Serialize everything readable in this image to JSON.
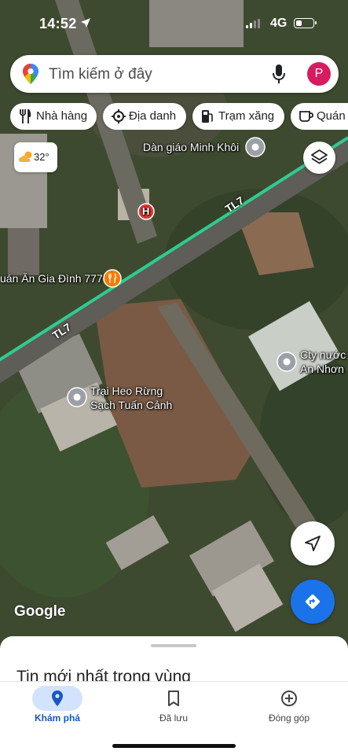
{
  "status_bar": {
    "time": "14:52",
    "network": "4G",
    "battery_level": 0.35
  },
  "search": {
    "placeholder": "Tìm kiếm ở đây",
    "avatar_letter": "P",
    "avatar_color": "#d81b60"
  },
  "chips": [
    {
      "label": "Nhà hàng",
      "icon": "utensils-icon"
    },
    {
      "label": "Địa danh",
      "icon": "landmark-icon"
    },
    {
      "label": "Trạm xăng",
      "icon": "fuel-icon"
    },
    {
      "label": "Quán",
      "icon": "coffee-icon"
    }
  ],
  "weather": {
    "temperature": "32°",
    "icon": "partly-cloudy-icon"
  },
  "map": {
    "road_name": "TL7",
    "road_color": "#2ecc8f",
    "places": [
      {
        "name": "Dàn giáo Minh Khôi",
        "icon": "pin-icon"
      },
      {
        "name": "uán Ăn Gia Đình 777",
        "icon": "restaurant-icon"
      },
      {
        "name": "Trại Heo Rừng",
        "name2": "Sạch Tuấn Cảnh",
        "icon": "pin-icon"
      },
      {
        "name": "Cty nước",
        "name2": "An Nhơn",
        "icon": "pin-icon"
      },
      {
        "name": "H",
        "icon": "hospital-icon"
      }
    ],
    "logo": "Google"
  },
  "sheet": {
    "title": "Tin mới nhất trong vùng"
  },
  "bottom_nav": [
    {
      "label": "Khám phá",
      "icon": "explore-pin-icon",
      "active": true
    },
    {
      "label": "Đã lưu",
      "icon": "bookmark-icon",
      "active": false
    },
    {
      "label": "Đóng góp",
      "icon": "add-circle-icon",
      "active": false
    }
  ],
  "accent_color": "#1a73e8"
}
